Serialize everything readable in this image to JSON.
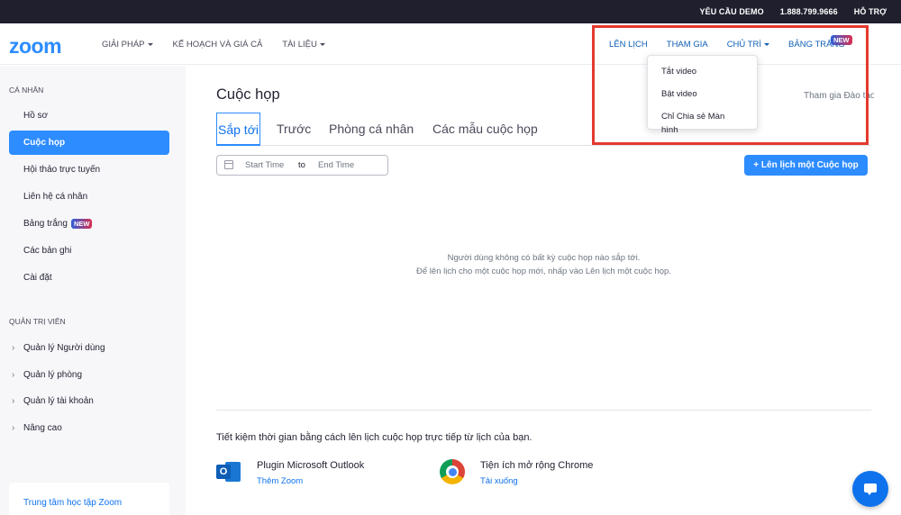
{
  "topbar": {
    "request_demo": "YÊU CẦU DEMO",
    "phone": "1.888.799.9666",
    "support": "HỖ TRỢ"
  },
  "header": {
    "logo": "zoom",
    "nav_left": [
      "GIẢI PHÁP",
      "KẾ HOẠCH VÀ GIÁ CẢ",
      "TÀI LIỆU"
    ],
    "nav_right": {
      "schedule": "LÊN LỊCH",
      "join": "THAM GIA",
      "host": "CHỦ TRÌ",
      "whiteboard": "BẢNG TRẮNG",
      "new_badge": "NEW"
    },
    "host_dropdown": [
      "Tắt video",
      "Bật video",
      "Chỉ Chia sẻ Màn hình"
    ]
  },
  "sidebar": {
    "personal_section": "CÁ NHÂN",
    "personal_items": [
      "Hồ sơ",
      "Cuộc họp",
      "Hội thảo trực tuyến",
      "Liên hệ cá nhân",
      "Bảng trắng",
      "Các bản ghi",
      "Cài đặt"
    ],
    "new_badge": "NEW",
    "admin_section": "QUẢN TRỊ VIÊN",
    "admin_items": [
      "Quản lý Người dùng",
      "Quản lý phòng",
      "Quản lý tài khoản",
      "Nâng cao"
    ],
    "learning_center": "Trung tâm học tập Zoom"
  },
  "main": {
    "title": "Cuộc họp",
    "join_training": "Tham gia Đào tạo",
    "tabs": [
      "Sắp tới",
      "Trước",
      "Phòng cá nhân",
      "Các mẫu cuộc họp"
    ],
    "date_start_placeholder": "Start Time",
    "date_to": "to",
    "date_end_placeholder": "End Time",
    "schedule_button": "+  Lên lịch một Cuộc họp",
    "empty_line1": "Người dùng không có bất kỳ cuộc họp nào sắp tới.",
    "empty_line2": "Để lên lịch cho một cuộc họp mới, nhấp vào Lên lịch một cuộc họp.",
    "save_time": "Tiết kiệm thời gian bằng cách lên lịch cuộc họp trực tiếp từ lịch của bạn.",
    "integrations": [
      {
        "title": "Plugin Microsoft Outlook",
        "link": "Thêm Zoom",
        "icon": "outlook-icon"
      },
      {
        "title": "Tiện ích mở rộng Chrome",
        "link": "Tải xuống",
        "icon": "chrome-icon"
      }
    ]
  },
  "colors": {
    "brand_blue": "#2d8cff",
    "highlight_red": "#e4392f",
    "topbar": "#1f1f2e"
  }
}
